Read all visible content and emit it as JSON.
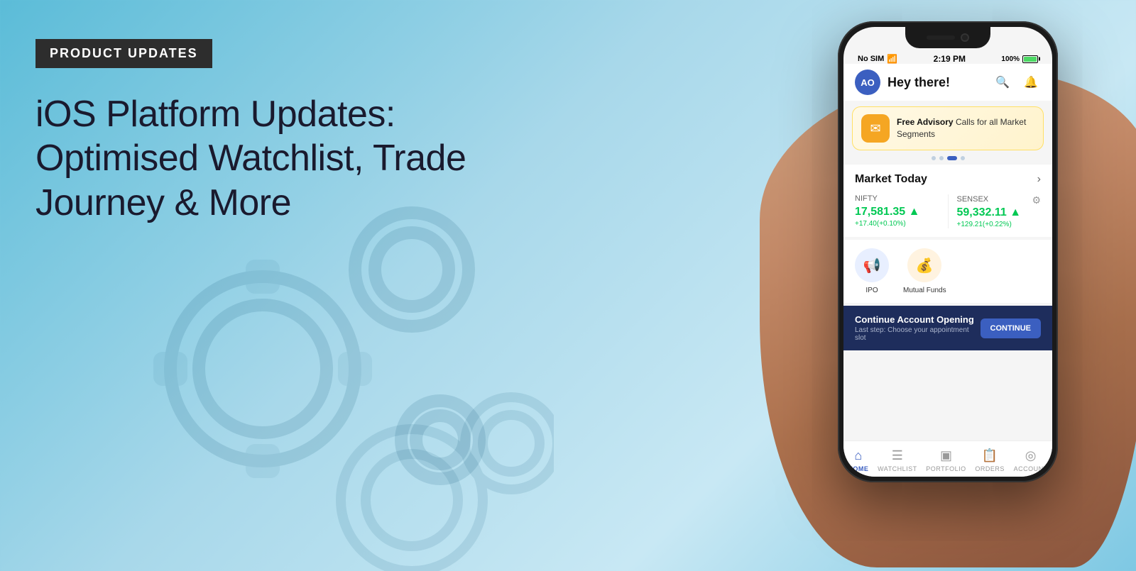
{
  "badge": {
    "label": "PRODUCT UPDATES"
  },
  "headline": {
    "line1": "iOS Platform Updates:",
    "line2": "Optimised Watchlist, Trade Journey & More"
  },
  "phone": {
    "status": {
      "carrier": "No SIM",
      "time": "2:19 PM",
      "battery": "100%"
    },
    "header": {
      "avatar_text": "AO",
      "greeting": "Hey there!"
    },
    "banner": {
      "icon": "✉",
      "text_bold": "Free Advisory",
      "text_normal": " Calls for all Market Segments"
    },
    "market": {
      "title": "Market Today",
      "nifty_label": "NIFTY",
      "nifty_value": "17,581.35 ▲",
      "nifty_change": "+17.40(+0.10%)",
      "sensex_label": "SENSEX",
      "sensex_value": "59,332.11 ▲",
      "sensex_change": "+129.21(+0.22%)"
    },
    "quick_access": [
      {
        "label": "IPO",
        "icon": "📢",
        "style": "blue"
      },
      {
        "label": "Mutual Funds",
        "icon": "💰",
        "style": "gold"
      }
    ],
    "account_banner": {
      "title": "Continue Account Opening",
      "subtitle": "Last step: Choose your appointment slot",
      "button": "CONTINUE"
    },
    "nav": [
      {
        "label": "HOME",
        "icon": "⌂",
        "active": true
      },
      {
        "label": "WATCHLIST",
        "icon": "☰",
        "active": false
      },
      {
        "label": "PORTFOLIO",
        "icon": "▣",
        "active": false
      },
      {
        "label": "ORDERS",
        "icon": "📋",
        "active": false
      },
      {
        "label": "ACCOUNT",
        "icon": "◎",
        "active": false
      }
    ]
  },
  "colors": {
    "badge_bg": "#2d2d2d",
    "background_start": "#5bbcd8",
    "background_end": "#a8d8ea",
    "accent_blue": "#3b5fc0",
    "positive_green": "#00c853",
    "headline_color": "#1a1a2e"
  }
}
